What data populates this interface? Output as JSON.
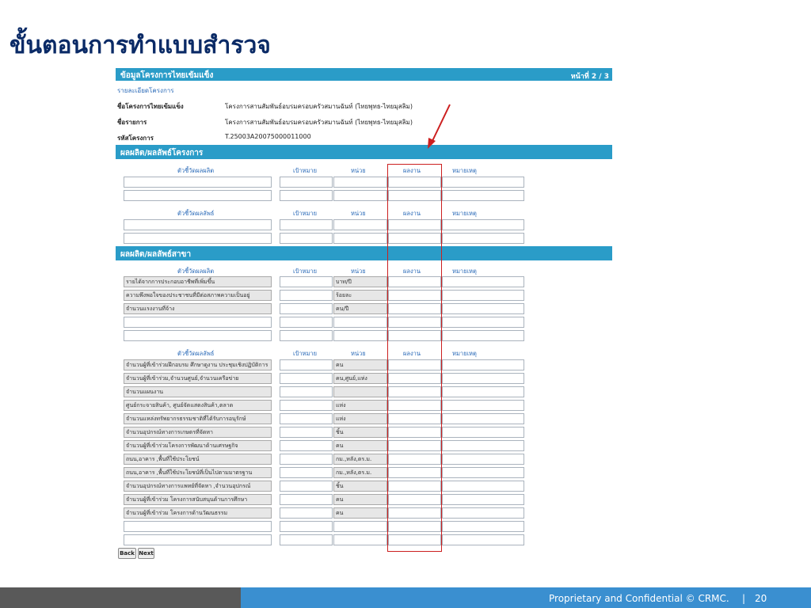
{
  "slide": {
    "title": "ขั้นตอนการทำแบบสำรวจ",
    "footer": "Proprietary and Confidential © CRMC.",
    "separator": "|",
    "page_number": "20"
  },
  "form": {
    "header_title": "ข้อมูลโครงการไทยเข้มแข็ง",
    "page_indicator": "หน้าที่ 2 / 3",
    "detail_link": "รายละเอียดโครงการ",
    "fields": [
      {
        "label": "ชื่อโครงการไทยเข้มแข็ง",
        "value": "โครงการสานสัมพันธ์อบรมครอบครัวสมานฉันท์ (ไทยพุทธ-ไทยมุสลิม)"
      },
      {
        "label": "ชื่อรายการ",
        "value": "โครงการสานสัมพันธ์อบรมครอบครัวสมานฉันท์ (ไทยพุทธ-ไทยมุสลิม)"
      },
      {
        "label": "รหัสโครงการ",
        "value": "T.25003A20075000011000"
      }
    ],
    "section1_title": "ผลผลิต/ผลลัพธ์โครงการ",
    "section2_title": "ผลผลิต/ผลลัพธ์สาขา",
    "col_output": "ตัวชี้วัดผลผลิต",
    "col_outcome": "ตัวชี้วัดผลลัพธ์",
    "col_target": "เป้าหมาย",
    "col_unit": "หน่วย",
    "col_result": "ผลงาน",
    "col_note": "หมายเหตุ",
    "s2_outputs": [
      {
        "name": "รายได้จากการประกอบอาชีพที่เพิ่มขึ้น",
        "unit": "บาท/ปี"
      },
      {
        "name": "ความพึงพอใจของประชาชนที่มีต่อสภาพความเป็นอยู่",
        "unit": "ร้อยละ"
      },
      {
        "name": "จำนวนแรงงานที่จ้าง",
        "unit": "คน/ปี"
      },
      {
        "name": "",
        "unit": ""
      },
      {
        "name": "",
        "unit": ""
      }
    ],
    "s2_outcomes": [
      {
        "name": "จำนวนผู้ที่เข้าร่วมฝึกอบรม ศึกษาดูงาน ประชุมเชิงปฏิบัติการ",
        "unit": "คน"
      },
      {
        "name": "จำนวนผู้ที่เข้าร่วม,จำนวนศูนย์,จำนวนเครือข่าย",
        "unit": "คน,ศูนย์,แห่ง"
      },
      {
        "name": "จำนวนแผนงาน",
        "unit": ""
      },
      {
        "name": "ศูนย์กระจายสินค้า, ศูนย์จัดแสดงสินค้า,ตลาด",
        "unit": "แห่ง"
      },
      {
        "name": "จำนวนแหล่งทรัพยากรธรรมชาติที่ได้รับการอนุรักษ์",
        "unit": "แห่ง"
      },
      {
        "name": "จำนวนอุปกรณ์ทางการเกษตรที่จัดหา",
        "unit": "ชิ้น"
      },
      {
        "name": "จำนวนผู้ที่เข้าร่วมโครงการพัฒนาด้านเศรษฐกิจ",
        "unit": "คน"
      },
      {
        "name": "ถนน,อาคาร ,พื้นที่ใช้ประโยชน์",
        "unit": "กม.,หลัง,ตร.ม."
      },
      {
        "name": "ถนน,อาคาร ,พื้นที่ใช้ประโยชน์ที่เป็นไปตามมาตรฐาน",
        "unit": "กม.,หลัง,ตร.ม."
      },
      {
        "name": "จำนวนอุปกรณ์ทางการแพทย์ที่จัดหา ,จำนวนอุปกรณ์",
        "unit": "ชิ้น"
      },
      {
        "name": "จำนวนผู้ที่เข้าร่วม โครงการสนับสนุนด้านการศึกษา",
        "unit": "คน"
      },
      {
        "name": "จำนวนผู้ที่เข้าร่วม โครงการด้านวัฒนธรรม",
        "unit": "คน"
      },
      {
        "name": "",
        "unit": ""
      },
      {
        "name": "",
        "unit": ""
      }
    ],
    "back_label": "Back",
    "next_label": "Next"
  }
}
